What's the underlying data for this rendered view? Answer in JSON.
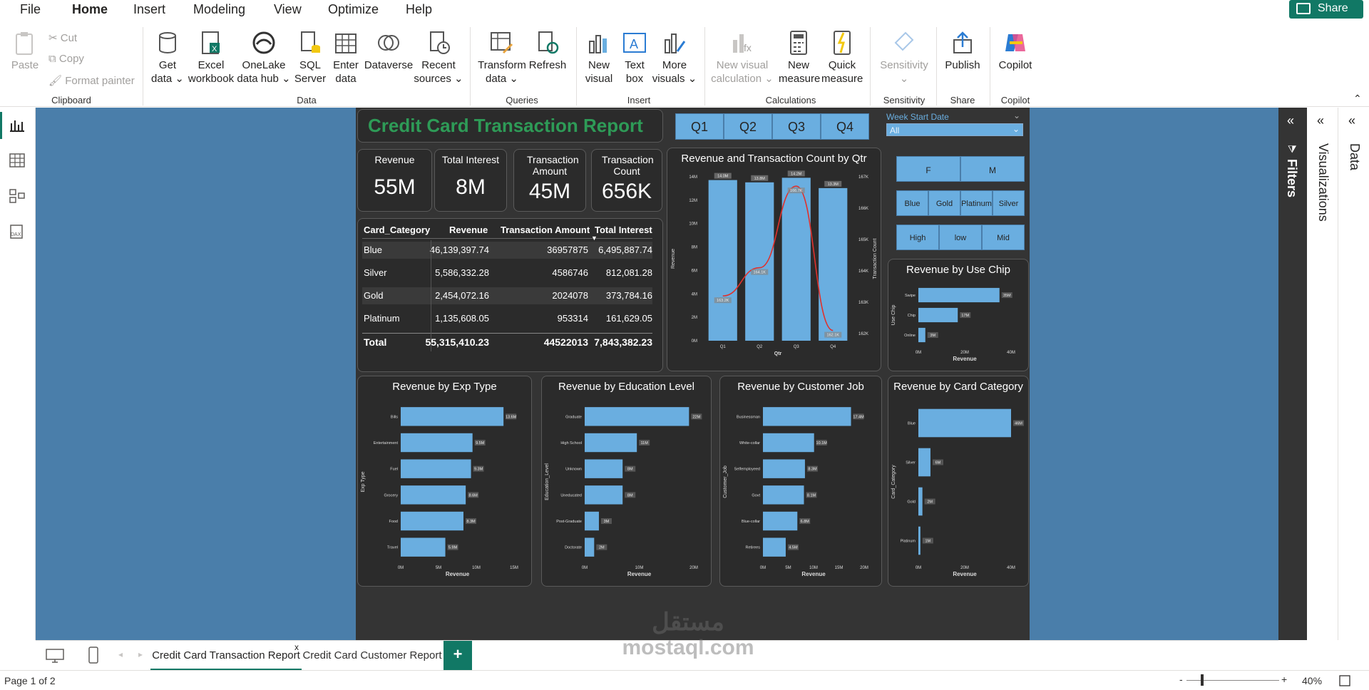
{
  "menu": {
    "items": [
      "File",
      "Home",
      "Insert",
      "Modeling",
      "View",
      "Optimize",
      "Help"
    ],
    "active": "Home",
    "share": "Share"
  },
  "ribbon": {
    "paste": "Paste",
    "cut": "Cut",
    "copy": "Copy",
    "format_painter": "Format painter",
    "get_data": [
      "Get",
      "data"
    ],
    "excel": [
      "Excel",
      "workbook"
    ],
    "onelake": [
      "OneLake",
      "data hub"
    ],
    "sql": [
      "SQL",
      "Server"
    ],
    "enter": [
      "Enter",
      "data"
    ],
    "dataverse": "Dataverse",
    "recent": [
      "Recent",
      "sources"
    ],
    "transform": [
      "Transform",
      "data"
    ],
    "refresh": "Refresh",
    "new_visual": [
      "New",
      "visual"
    ],
    "text_box": [
      "Text",
      "box"
    ],
    "more_visuals": [
      "More",
      "visuals"
    ],
    "new_visual_calc": [
      "New visual",
      "calculation"
    ],
    "new_measure": [
      "New",
      "measure"
    ],
    "quick_measure": [
      "Quick",
      "measure"
    ],
    "sensitivity": "Sensitivity",
    "publish": "Publish",
    "copilot": "Copilot",
    "groups": {
      "clipboard": "Clipboard",
      "data": "Data",
      "queries": "Queries",
      "insert": "Insert",
      "calculations": "Calculations",
      "sensitivity": "Sensitivity",
      "share": "Share",
      "copilot": "Copilot"
    }
  },
  "report": {
    "title": "Credit Card Transaction Report",
    "quarters": [
      "Q1",
      "Q2",
      "Q3",
      "Q4"
    ],
    "week_slicer": {
      "label": "Week Start Date",
      "value": "All"
    },
    "cards": [
      {
        "label": "Revenue",
        "value": "55M"
      },
      {
        "label": "Total Interest",
        "value": "8M"
      },
      {
        "label": "Transaction Amount",
        "value": "45M"
      },
      {
        "label": "Transaction Count",
        "value": "656K"
      }
    ],
    "slicers": {
      "gender": [
        "F",
        "M"
      ],
      "category": [
        "Blue",
        "Gold",
        "Platinum",
        "Silver"
      ],
      "income": [
        "High",
        "low",
        "Mid"
      ]
    },
    "table": {
      "headers": [
        "Card_Category",
        "Revenue",
        "Transaction Amount",
        "Total Interest"
      ],
      "rows": [
        [
          "Blue",
          "46,139,397.74",
          "36957875",
          "6,495,887.74"
        ],
        [
          "Silver",
          "5,586,332.28",
          "4586746",
          "812,081.28"
        ],
        [
          "Gold",
          "2,454,072.16",
          "2024078",
          "373,784.16"
        ],
        [
          "Platinum",
          "1,135,608.05",
          "953314",
          "161,629.05"
        ]
      ],
      "total": [
        "Total",
        "55,315,410.23",
        "44522013",
        "7,843,382.23"
      ]
    }
  },
  "chart_data": [
    {
      "type": "bar",
      "title": "Revenue and Transaction Count by Qtr",
      "categories": [
        "Q1",
        "Q2",
        "Q3",
        "Q4"
      ],
      "xlabel": "Qtr",
      "ylabel": "Revenue",
      "y2label": "Transaction Count",
      "yticks": [
        "0M",
        "2M",
        "4M",
        "6M",
        "8M",
        "10M",
        "12M",
        "14M"
      ],
      "y2ticks": [
        "162K",
        "163K",
        "164K",
        "165K",
        "166K",
        "167K"
      ],
      "series": [
        {
          "name": "Revenue",
          "values": [
            14.0,
            13.8,
            14.2,
            13.3
          ],
          "labels": [
            "14.0M",
            "13.8M",
            "14.2M",
            "13.3M"
          ]
        },
        {
          "name": "Transaction Count",
          "values": [
            163.2,
            164.1,
            166.7,
            162.1
          ],
          "labels": [
            "163.2K",
            "164.1K",
            "166.7K",
            "162.1K"
          ]
        }
      ]
    },
    {
      "type": "bar",
      "title": "Revenue by Use Chip",
      "categories": [
        "Swipe",
        "Chip",
        "Online"
      ],
      "values": [
        35,
        17,
        3
      ],
      "labels": [
        "35M",
        "17M",
        "3M"
      ],
      "xlabel": "Revenue",
      "ylabel": "Use Chip",
      "xticks": [
        "0M",
        "20M",
        "40M"
      ],
      "xlim": [
        0,
        40
      ]
    },
    {
      "type": "bar",
      "title": "Revenue by Exp Type",
      "categories": [
        "Bills",
        "Entertainment",
        "Fuel",
        "Grocery",
        "Food",
        "Travel"
      ],
      "values": [
        13.6,
        9.5,
        9.3,
        8.6,
        8.3,
        5.9
      ],
      "labels": [
        "13.6M",
        "9.5M",
        "9.3M",
        "8.6M",
        "8.3M",
        "5.9M"
      ],
      "xlabel": "Revenue",
      "ylabel": "Exp Type",
      "xticks": [
        "0M",
        "5M",
        "10M",
        "15M"
      ],
      "xlim": [
        0,
        15
      ]
    },
    {
      "type": "bar",
      "title": "Revenue by Education Level",
      "categories": [
        "Graduate",
        "High School",
        "Unknown",
        "Uneducated",
        "Post-Graduate",
        "Doctorate"
      ],
      "values": [
        22,
        11,
        8,
        8,
        3,
        2
      ],
      "labels": [
        "22M",
        "11M",
        "8M",
        "8M",
        "3M",
        "2M"
      ],
      "xlabel": "Revenue",
      "ylabel": "Education_Level",
      "xticks": [
        "0M",
        "10M",
        "20M"
      ],
      "xlim": [
        0,
        23
      ]
    },
    {
      "type": "bar",
      "title": "Revenue by Customer Job",
      "categories": [
        "Businessman",
        "White-collar",
        "Selfemployeed",
        "Govt",
        "Blue-collar",
        "Retirees"
      ],
      "values": [
        17.4,
        10.1,
        8.3,
        8.1,
        6.8,
        4.5
      ],
      "labels": [
        "17.4M",
        "10.1M",
        "8.3M",
        "8.1M",
        "6.8M",
        "4.5M"
      ],
      "xlabel": "Revenue",
      "ylabel": "Customer_Job",
      "xticks": [
        "0M",
        "5M",
        "10M",
        "15M",
        "20M"
      ],
      "xlim": [
        0,
        20
      ]
    },
    {
      "type": "bar",
      "title": "Revenue by Card Category",
      "categories": [
        "Blue",
        "Silver",
        "Gold",
        "Platinum"
      ],
      "values": [
        46,
        6,
        2,
        1
      ],
      "labels": [
        "46M",
        "6M",
        "2M",
        "1M"
      ],
      "xlabel": "Revenue",
      "ylabel": "Card_Category",
      "xticks": [
        "0M",
        "20M",
        "40M"
      ],
      "xlim": [
        0,
        46
      ]
    }
  ],
  "right": {
    "filters": "Filters",
    "visualizations": "Visualizations",
    "data": "Data"
  },
  "tabs": {
    "items": [
      "Credit Card Transaction Report",
      "Credit Card Customer Report"
    ],
    "close": "x",
    "add": "+"
  },
  "status": {
    "page": "Page 1 of 2",
    "zoom": "40%",
    "minus": "-",
    "plus": "+"
  },
  "watermark": {
    "arabic": "مستقل",
    "latin": "mostaql.com"
  },
  "colors": {
    "accent": "#117865",
    "bar": "#6aaee0",
    "line": "#e0312c",
    "report_bg": "#343434",
    "canvas": "#4a7eaa"
  }
}
